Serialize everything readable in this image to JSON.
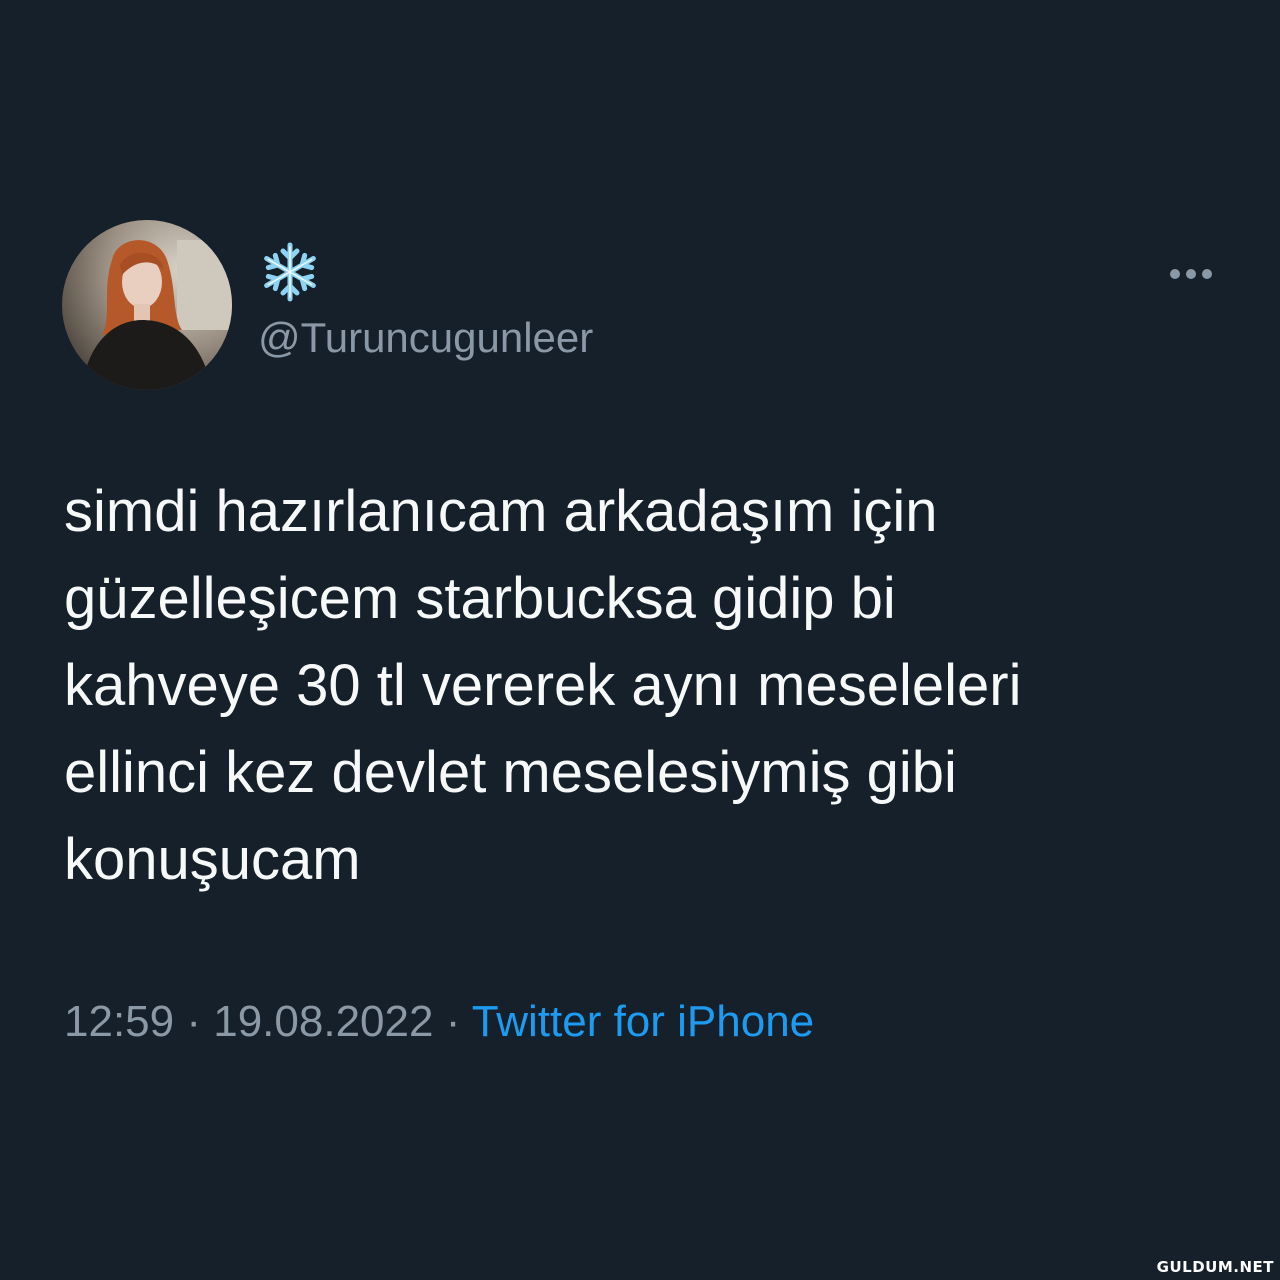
{
  "user": {
    "display_name_icon": "snowflake-icon",
    "handle": "@Turuncugunleer",
    "avatar": "avatar-photo"
  },
  "menu": {
    "icon": "more-icon"
  },
  "tweet": {
    "lines": [
      "simdi hazırlanıcam arkadaşım için",
      "güzelleşicem starbucksa gidip bi",
      "kahveye 30 tl vererek aynı meseleleri",
      "ellinci kez devlet meselesiymiş gibi",
      "konuşucam"
    ]
  },
  "meta": {
    "time": "12:59",
    "separator": "·",
    "date": "19.08.2022",
    "source": "Twitter for iPhone"
  },
  "watermark": {
    "text": "GULDUM.NET"
  },
  "colors": {
    "background": "#15202b",
    "text": "#f7f9f9",
    "muted": "#8b98a5",
    "accent": "#1d9bf0"
  }
}
